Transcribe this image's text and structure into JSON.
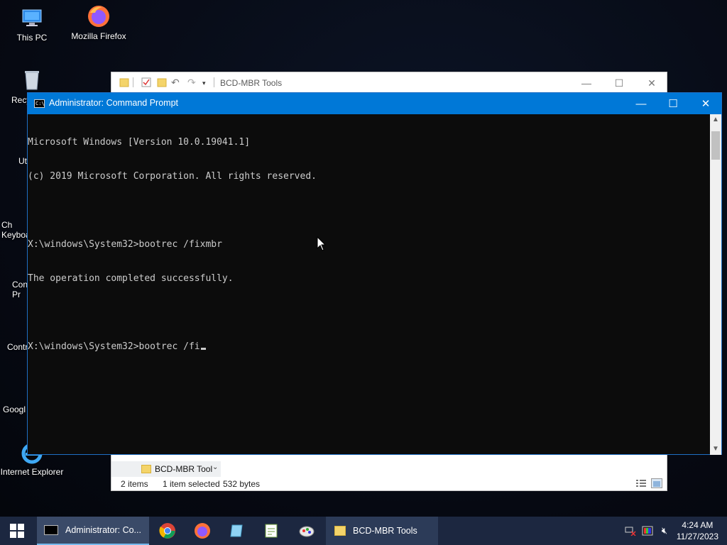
{
  "desktop": {
    "icons": [
      {
        "name": "This PC"
      },
      {
        "name": "Mozilla Firefox"
      },
      {
        "name": "Recy"
      },
      {
        "name": "Ut"
      },
      {
        "name": "Ch\nKeyboa"
      },
      {
        "name": "Con\nPr"
      },
      {
        "name": "Contr"
      },
      {
        "name": "Googl"
      },
      {
        "name": "Internet Explorer"
      }
    ]
  },
  "explorer": {
    "title": "BCD-MBR Tools",
    "nav_item": "BCD-MBR Tool",
    "status": {
      "items": "2 items",
      "selected": "1 item selected",
      "size": "532 bytes"
    }
  },
  "cmd": {
    "title": "Administrator: Command Prompt",
    "lines": [
      "Microsoft Windows [Version 10.0.19041.1]",
      "(c) 2019 Microsoft Corporation. All rights reserved.",
      "",
      "X:\\windows\\System32>bootrec /fixmbr",
      "The operation completed successfully.",
      "",
      "X:\\windows\\System32>bootrec /fi"
    ]
  },
  "taskbar": {
    "active_window": "Administrator: Co...",
    "explorer_window": "BCD-MBR Tools",
    "pinned": [
      "chrome-icon",
      "firefox-icon",
      "notepad-icon",
      "editor-icon",
      "paint-icon"
    ],
    "time": "4:24 AM",
    "date": "11/27/2023"
  },
  "colors": {
    "titlebar_accent": "#0078d7",
    "console_bg": "#0c0c0c",
    "console_text": "#cccccc",
    "taskbar_bg": "#1c2740"
  }
}
